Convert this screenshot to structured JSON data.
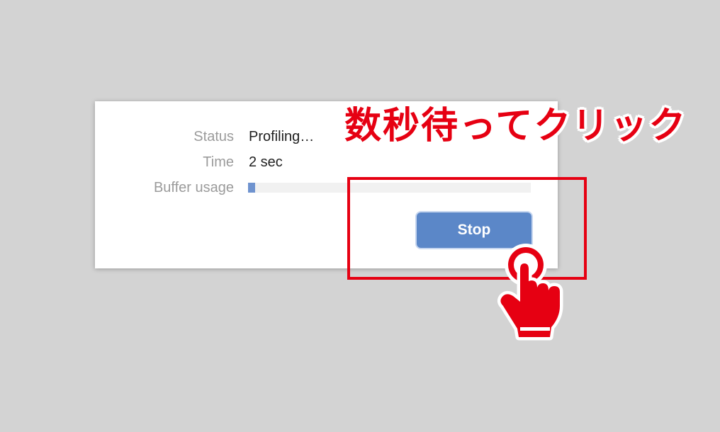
{
  "dialog": {
    "status_label": "Status",
    "status_value": "Profiling…",
    "time_label": "Time",
    "time_value": "2 sec",
    "buffer_label": "Buffer usage",
    "buffer_usage_fraction": 0.025,
    "stop_label": "Stop"
  },
  "annotation": {
    "text": "数秒待ってクリック",
    "color": "#e60012",
    "icon": "hand-pointer-icon"
  },
  "colors": {
    "background": "#d3d3d3",
    "button": "#5b87c8",
    "buffer_fill": "#6f93cf"
  }
}
